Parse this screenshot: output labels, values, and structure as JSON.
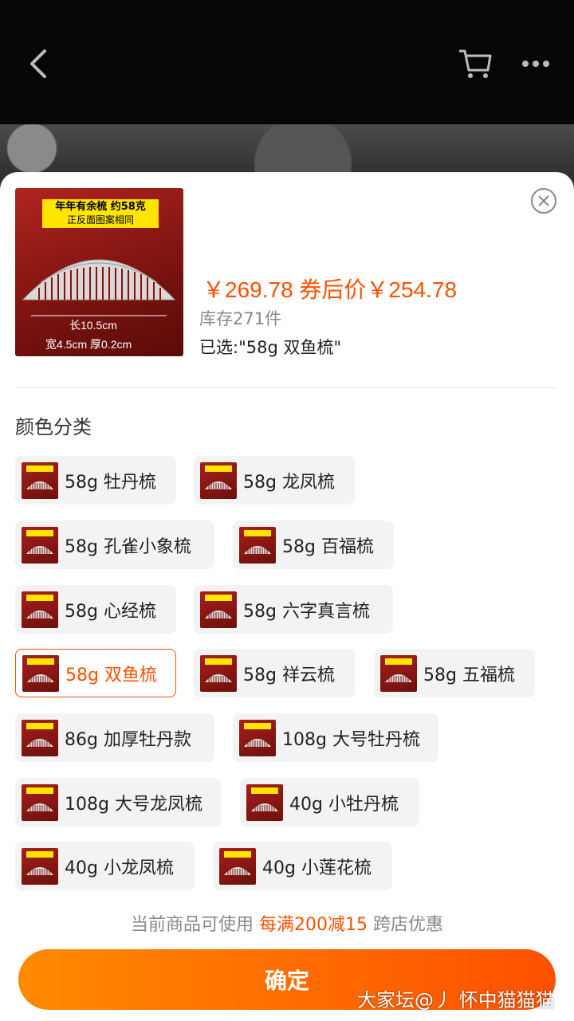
{
  "header": {
    "back_icon": "chevron-left-icon",
    "cart_icon": "cart-icon",
    "more_icon": "more-dots-icon"
  },
  "product": {
    "thumb_banner_line1": "年年有余梳 约58克",
    "thumb_banner_line2": "正反面图案相同",
    "thumb_length": "长10.5cm",
    "thumb_width_thickness": "宽4.5cm 厚0.2cm",
    "price_line": "￥269.78 券后价￥254.78",
    "stock": "库存271件",
    "selected": "已选:\"58g 双鱼梳\""
  },
  "variants": {
    "title": "颜色分类",
    "options": [
      {
        "label": "58g 牡丹梳",
        "selected": false
      },
      {
        "label": "58g 龙凤梳",
        "selected": false
      },
      {
        "label": "58g 孔雀小象梳",
        "selected": false
      },
      {
        "label": "58g 百福梳",
        "selected": false
      },
      {
        "label": "58g 心经梳",
        "selected": false
      },
      {
        "label": "58g 六字真言梳",
        "selected": false
      },
      {
        "label": "58g 双鱼梳",
        "selected": true
      },
      {
        "label": "58g 祥云梳",
        "selected": false
      },
      {
        "label": "58g 五福梳",
        "selected": false
      },
      {
        "label": "86g 加厚牡丹款",
        "selected": false
      },
      {
        "label": "108g 大号牡丹梳",
        "selected": false
      },
      {
        "label": "108g 大号龙凤梳",
        "selected": false
      },
      {
        "label": "40g 小牡丹梳",
        "selected": false
      },
      {
        "label": "40g 小龙凤梳",
        "selected": false
      },
      {
        "label": "40g 小莲花梳",
        "selected": false
      }
    ]
  },
  "promo": {
    "prefix": "当前商品可使用",
    "highlight": "每满200减15",
    "suffix": "跨店优惠"
  },
  "confirm_label": "确定",
  "watermark": "大家坛@丿 怀中猫猫猫",
  "colors": {
    "accent": "#ff5000",
    "button_start": "#ff8a00",
    "button_end": "#ff5000"
  }
}
